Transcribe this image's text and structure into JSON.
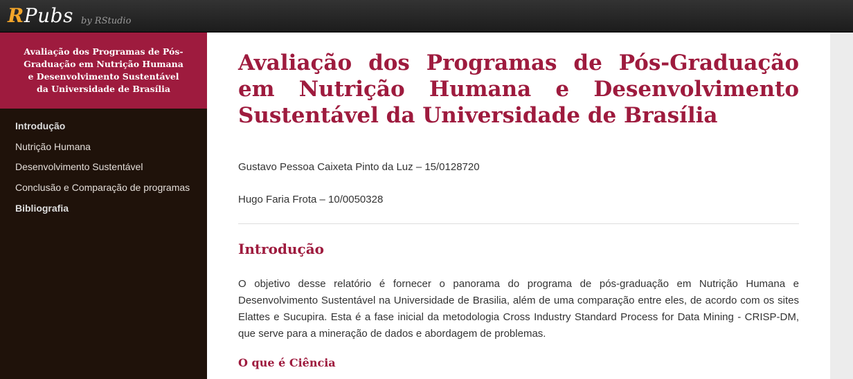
{
  "topbar": {
    "logo_r": "R",
    "logo_rest": "Pubs",
    "byline": "by RStudio"
  },
  "sidebar": {
    "header": "Avaliação dos Programas de Pós-Graduação em Nutrição Humana e Desenvolvimento Sustentável da Universidade de Brasília",
    "items": [
      {
        "label": "Introdução"
      },
      {
        "label": "Nutrição Humana"
      },
      {
        "label": "Desenvolvimento Sustentável"
      },
      {
        "label": "Conclusão e Comparação de programas"
      },
      {
        "label": "Bibliografia"
      }
    ]
  },
  "main": {
    "title": "Avaliação dos Programas de Pós-Graduação em Nutrição Humana e Desenvolvimento Sustentável da Universidade de Brasília",
    "authors": [
      "Gustavo Pessoa Caixeta Pinto da Luz – 15/0128720",
      "Hugo Faria Frota – 10/0050328"
    ],
    "section_title": "Introdução",
    "intro_paragraph": "O objetivo desse relatório é fornecer o panorama do programa de pós-graduação em Nutrição Humana e Desenvolvimento Sustentável na Universidade de Brasilia, além de uma comparação entre eles, de acordo com os sites Elattes e Sucupira. Esta é a fase inicial da metodologia Cross Industry Standard Process for Data Mining - CRISP-DM, que serve para a mineração de dados e abordagem de problemas.",
    "subsection_title": "O que é Ciência"
  }
}
